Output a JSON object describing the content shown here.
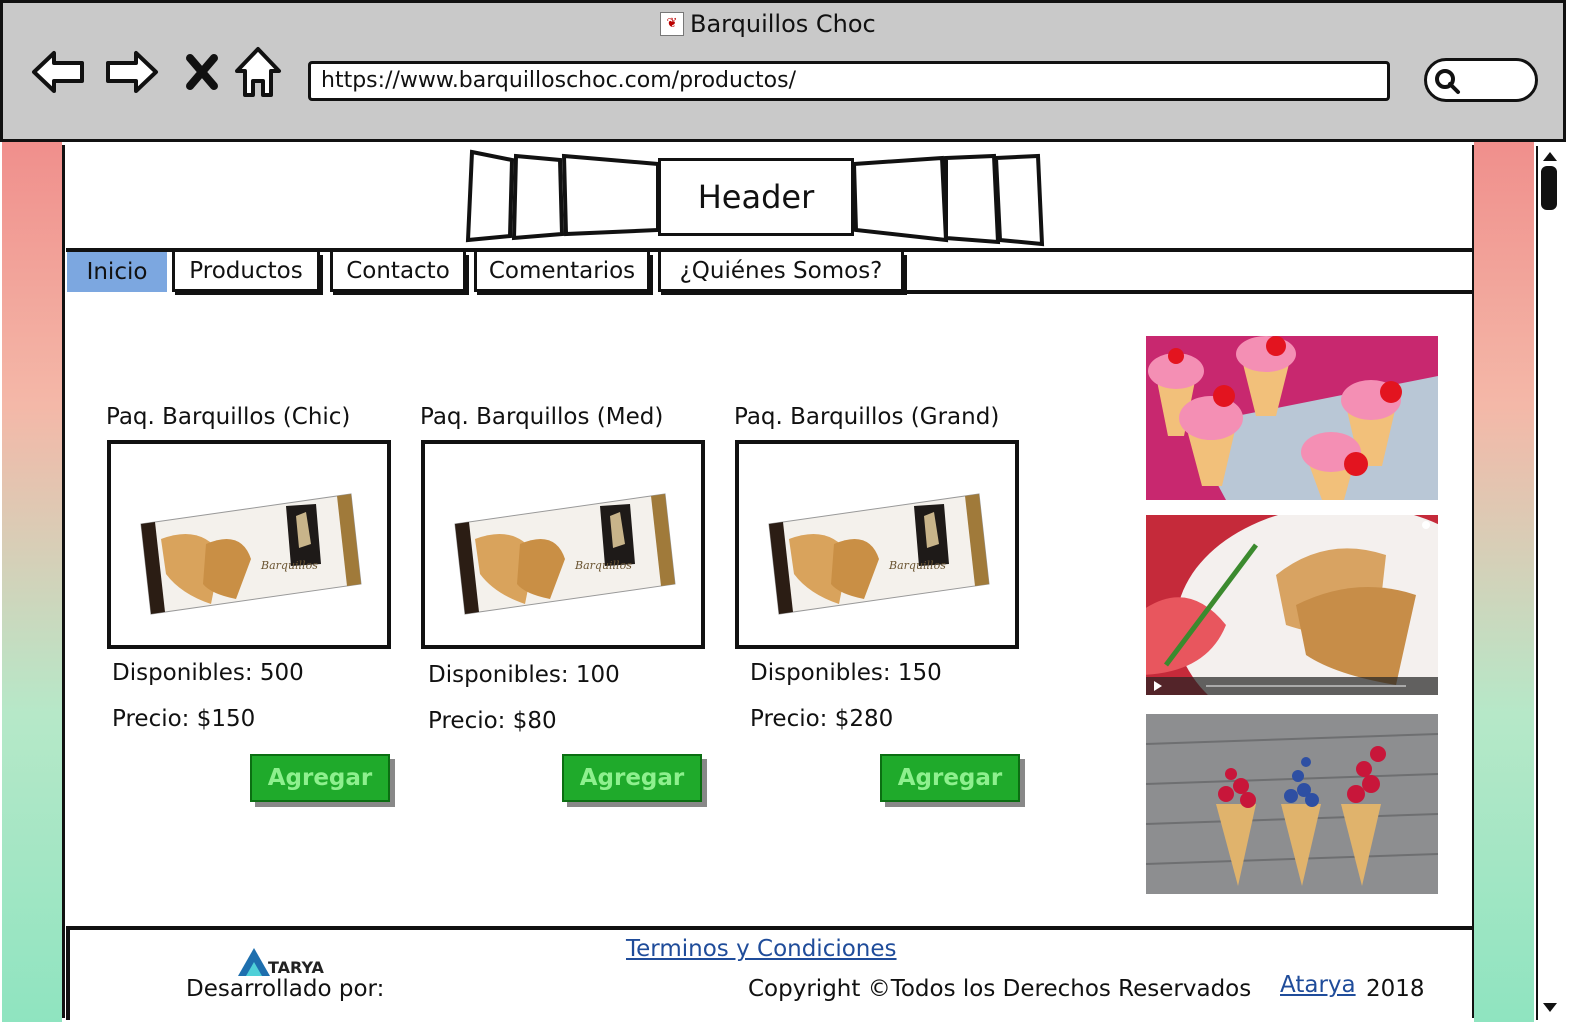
{
  "window": {
    "title": "Barquillos Choc",
    "favicon": "favicon-icon"
  },
  "browser": {
    "url": "https://www.barquilloschoc.com/productos/",
    "nav_icons": [
      "back-arrow-icon",
      "forward-arrow-icon",
      "close-icon",
      "home-icon"
    ],
    "search_icon": "search-icon"
  },
  "header": {
    "label": "Header"
  },
  "tabs": [
    {
      "label": "Inicio",
      "active": true
    },
    {
      "label": "Productos",
      "active": false
    },
    {
      "label": "Contacto",
      "active": false
    },
    {
      "label": "Comentarios",
      "active": false
    },
    {
      "label": "¿Quiénes Somos?",
      "active": false
    }
  ],
  "products": [
    {
      "title": "Paq. Barquillos (Chic)",
      "disponibles": "Disponibles: 500",
      "precio": "Precio: $150",
      "button": "Agregar"
    },
    {
      "title": "Paq. Barquillos (Med)",
      "disponibles": "Disponibles: 100",
      "precio": "Precio: $80",
      "button": "Agregar"
    },
    {
      "title": "Paq. Barquillos (Grand)",
      "disponibles": "Disponibles: 150",
      "precio": "Precio: $280",
      "button": "Agregar"
    }
  ],
  "colors": {
    "tab_active": "#7ca7e0",
    "button_green": "#1faa2b",
    "link_blue": "#1f4c9a",
    "chrome_gray": "#c9c9c9"
  },
  "footer": {
    "terms_link": "Terminos y Condiciones",
    "logo_text": "TARYA",
    "developed_by": "Desarrollado por:",
    "copyright": "Copyright ©Todos los Derechos Reservados",
    "brand_link": "Atarya",
    "year": "2018"
  }
}
